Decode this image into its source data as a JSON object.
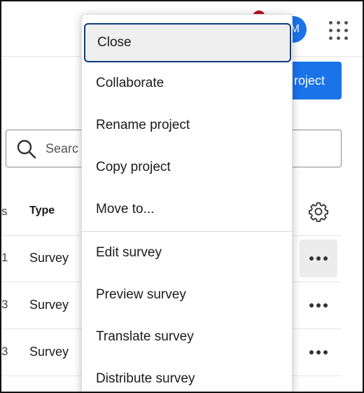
{
  "header": {
    "avatar_initial": "M",
    "primary_button_label": "roject"
  },
  "search": {
    "placeholder_fragment": "Searc"
  },
  "table": {
    "header_type": "Type",
    "left_fragments": [
      "s",
      "1",
      "3",
      "3"
    ],
    "rows": [
      {
        "type": "Survey"
      },
      {
        "type": "Survey"
      },
      {
        "type": "Survey"
      }
    ]
  },
  "menu": {
    "group1": [
      "Close",
      "Collaborate",
      "Rename project",
      "Copy project",
      "Move to..."
    ],
    "group2": [
      "Edit survey",
      "Preview survey",
      "Translate survey",
      "Distribute survey"
    ]
  },
  "colors": {
    "accent": "#1a73e8",
    "notification": "#b5121b",
    "focus_ring": "#0b3b7a"
  }
}
